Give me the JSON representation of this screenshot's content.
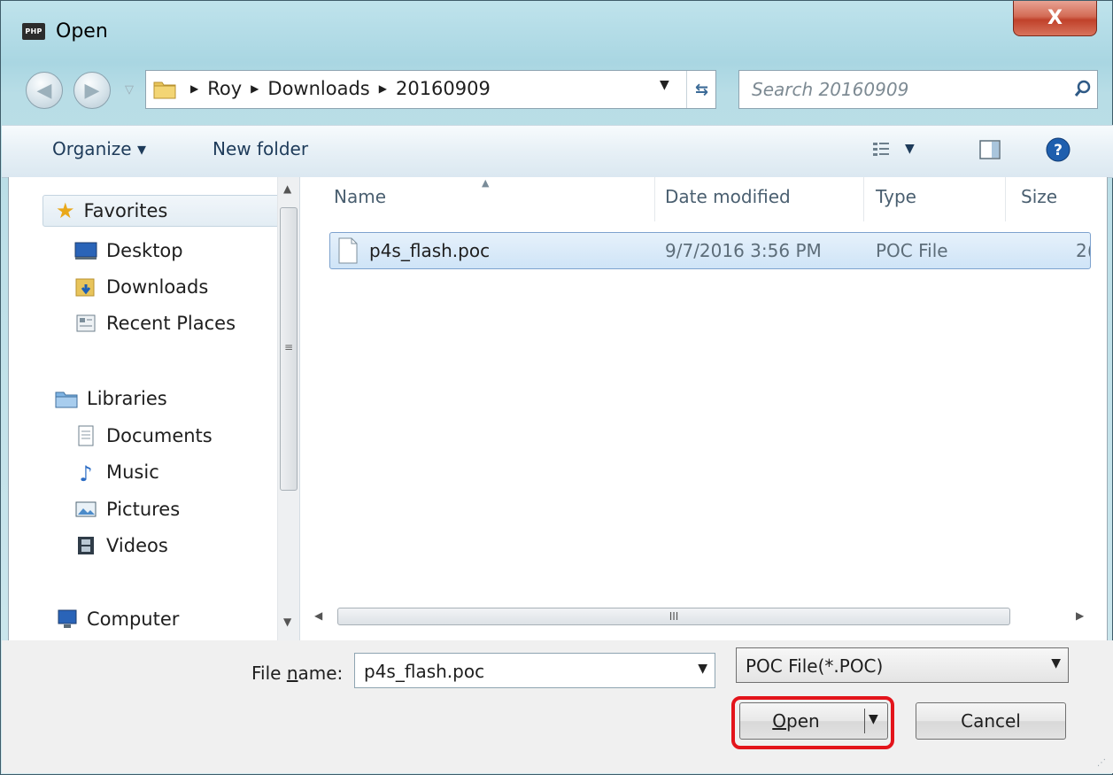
{
  "window": {
    "title": "Open",
    "app_badge": "PHP",
    "close_glyph": "X"
  },
  "address": {
    "crumbs": [
      "Roy",
      "Downloads",
      "20160909"
    ]
  },
  "search": {
    "placeholder": "Search 20160909"
  },
  "toolbar": {
    "organize": "Organize ▾",
    "new_folder": "New folder"
  },
  "nav": {
    "favorites": {
      "label": "Favorites",
      "items": [
        "Desktop",
        "Downloads",
        "Recent Places"
      ]
    },
    "libraries": {
      "label": "Libraries",
      "items": [
        "Documents",
        "Music",
        "Pictures",
        "Videos"
      ]
    },
    "computer": {
      "label": "Computer"
    }
  },
  "columns": {
    "name": "Name",
    "date": "Date modified",
    "type": "Type",
    "size": "Size"
  },
  "files": [
    {
      "name": "p4s_flash.poc",
      "date": "9/7/2016 3:56 PM",
      "type": "POC File",
      "size_partial": "2("
    }
  ],
  "bottom": {
    "filename_label_pre": "File ",
    "filename_label_u": "n",
    "filename_label_post": "ame:",
    "filename_value": "p4s_flash.poc",
    "filter_value": "POC File(*.POC)",
    "open_u": "O",
    "open_rest": "pen",
    "cancel": "Cancel"
  },
  "colors": {
    "highlight": "#e3141b",
    "close": "#c0412a",
    "selection": "#cfe4f7"
  }
}
